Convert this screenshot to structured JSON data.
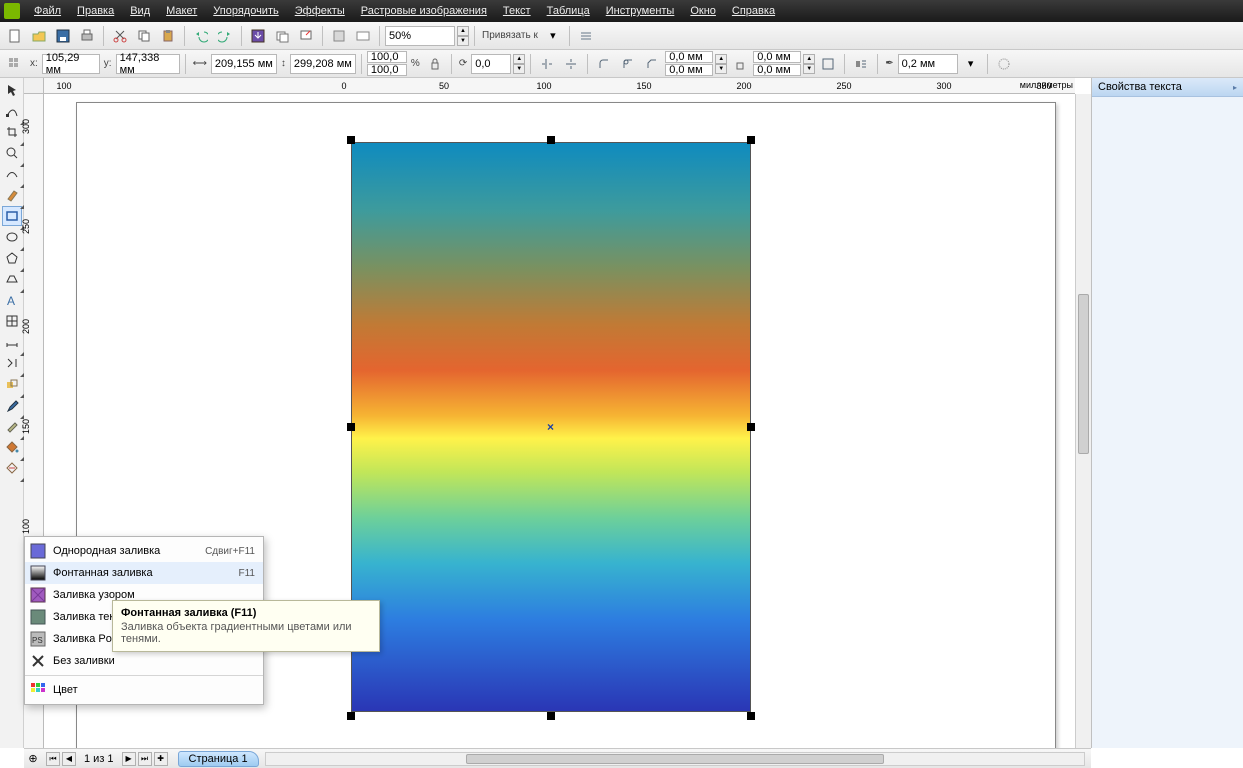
{
  "menu": [
    "Файл",
    "Правка",
    "Вид",
    "Макет",
    "Упорядочить",
    "Эффекты",
    "Растровые изображения",
    "Текст",
    "Таблица",
    "Инструменты",
    "Окно",
    "Справка"
  ],
  "zoom": "50%",
  "snap_label": "Привязать к",
  "coords": {
    "x_label": "x:",
    "x": "105,29 мм",
    "y_label": "y:",
    "y": "147,338 мм"
  },
  "size": {
    "w": "209,155 мм",
    "h": "299,208 мм"
  },
  "scale": {
    "sx": "100,0",
    "sy": "100,0",
    "pct": "%"
  },
  "rotate": "0,0",
  "offsetsA": {
    "x": "0,0 мм",
    "y": "0,0 мм"
  },
  "offsetsB": {
    "x": "0,0 мм",
    "y": "0,0 мм"
  },
  "outline": "0,2 мм",
  "ruler": {
    "h_unit": "миллиметры",
    "h_ticks": [
      "100",
      "0",
      "50",
      "100",
      "150",
      "200",
      "250",
      "300",
      "350"
    ],
    "v_ticks": [
      "300",
      "250",
      "200",
      "150",
      "100"
    ]
  },
  "right_panel_title": "Свойства текста",
  "pagebar": {
    "of": "1 из 1",
    "tab": "Страница 1"
  },
  "flyout": {
    "items": [
      {
        "label": "Однородная заливка",
        "shortcut": "Сдвиг+F11"
      },
      {
        "label": "Фонтанная заливка",
        "shortcut": "F11"
      },
      {
        "label": "Заливка узором",
        "shortcut": ""
      },
      {
        "label": "Заливка текстурой",
        "shortcut": ""
      },
      {
        "label": "Заливка PostScript",
        "shortcut": ""
      },
      {
        "label": "Без заливки",
        "shortcut": ""
      }
    ],
    "color_label": "Цвет"
  },
  "tooltip": {
    "title": "Фонтанная заливка (F11)",
    "body": "Заливка объекта градиентными цветами или тенями."
  }
}
